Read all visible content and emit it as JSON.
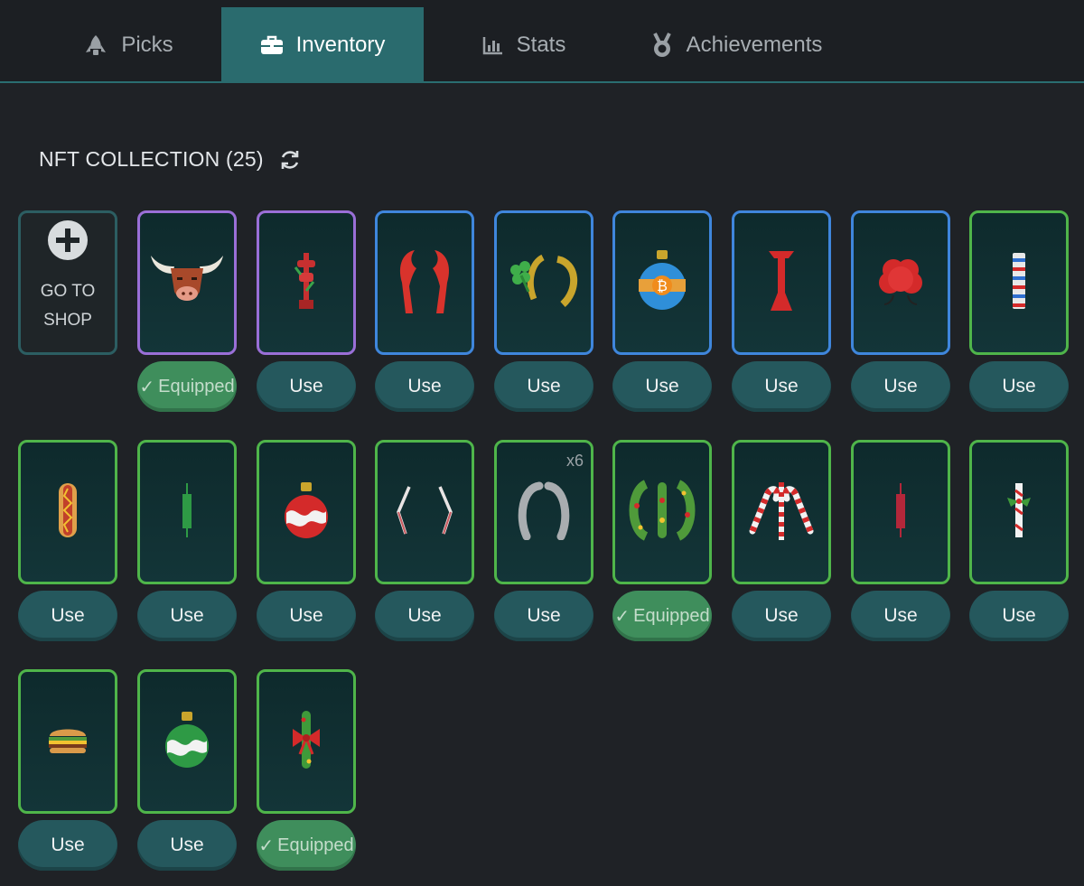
{
  "nav": {
    "tabs": [
      {
        "label": "Picks",
        "icon": "rocket-icon",
        "active": false
      },
      {
        "label": "Inventory",
        "icon": "briefcase-icon",
        "active": true
      },
      {
        "label": "Stats",
        "icon": "bar-chart-icon",
        "active": false
      },
      {
        "label": "Achievements",
        "icon": "medal-icon",
        "active": false
      }
    ]
  },
  "collection": {
    "title": "NFT COLLECTION (25)",
    "shop": {
      "line1": "GO TO",
      "line2": "SHOP",
      "icon": "plus-circle-icon"
    },
    "items": [
      {
        "name": "bull-head",
        "rarity": "purple",
        "button": "Equipped",
        "equipped": true
      },
      {
        "name": "red-candle-trinket",
        "rarity": "purple",
        "button": "Use",
        "equipped": false
      },
      {
        "name": "lobster-claws",
        "rarity": "blue",
        "button": "Use",
        "equipped": false
      },
      {
        "name": "clover-horseshoe",
        "rarity": "blue",
        "button": "Use",
        "equipped": false
      },
      {
        "name": "bitcoin-ornament",
        "rarity": "blue",
        "button": "Use",
        "equipped": false
      },
      {
        "name": "red-plunger",
        "rarity": "blue",
        "button": "Use",
        "equipped": false
      },
      {
        "name": "red-brain",
        "rarity": "blue",
        "button": "Use",
        "equipped": false
      },
      {
        "name": "chip-stack",
        "rarity": "green",
        "button": "Use",
        "equipped": false
      },
      {
        "name": "hotdog",
        "rarity": "green",
        "button": "Use",
        "equipped": false
      },
      {
        "name": "green-candle",
        "rarity": "green",
        "button": "Use",
        "equipped": false
      },
      {
        "name": "red-ornament",
        "rarity": "green",
        "button": "Use",
        "equipped": false
      },
      {
        "name": "bracket-arrows",
        "rarity": "green",
        "button": "Use",
        "equipped": false
      },
      {
        "name": "silver-horseshoes",
        "rarity": "green",
        "button": "Use",
        "equipped": false,
        "qty": "x6"
      },
      {
        "name": "wreath-garland",
        "rarity": "green",
        "button": "Equipped",
        "equipped": true
      },
      {
        "name": "candy-canes",
        "rarity": "green",
        "button": "Use",
        "equipped": false
      },
      {
        "name": "red-candle",
        "rarity": "green",
        "button": "Use",
        "equipped": false
      },
      {
        "name": "holly-candle",
        "rarity": "green",
        "button": "Use",
        "equipped": false
      },
      {
        "name": "burger",
        "rarity": "green",
        "button": "Use",
        "equipped": false
      },
      {
        "name": "green-ornament",
        "rarity": "green",
        "button": "Use",
        "equipped": false
      },
      {
        "name": "bow-garland",
        "rarity": "green",
        "button": "Equipped",
        "equipped": true
      }
    ]
  },
  "colors": {
    "background": "#1f2226",
    "accent_teal": "#2a6b6e",
    "rare_purple": "#9a6fd7",
    "rare_blue": "#3f86dc",
    "common_green": "#4fb54a",
    "equipped_green": "#3f8e5c"
  }
}
